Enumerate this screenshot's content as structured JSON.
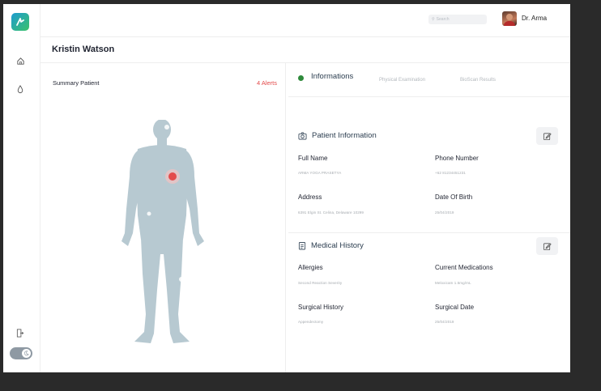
{
  "header": {
    "search_placeholder": "Search",
    "user_name": "Dr. Arma"
  },
  "patient": {
    "name": "Kristin Watson"
  },
  "summary": {
    "label": "Summary Patient",
    "alerts": "4 Alerts"
  },
  "tabs": [
    {
      "label": "Informations",
      "active": true
    },
    {
      "label": "Physical Examination",
      "active": false
    },
    {
      "label": "BioScan Results",
      "active": false
    }
  ],
  "patient_information": {
    "title": "Patient Information",
    "fields": [
      {
        "label": "Full Name",
        "value": "ARMA YOGA PRASETYA"
      },
      {
        "label": "Phone Number",
        "value": "+62 81234451231"
      },
      {
        "label": "Address",
        "value": "6391 Elgin St. Celina, Delaware 10299"
      },
      {
        "label": "Date Of Birth",
        "value": "25/04/2019"
      }
    ]
  },
  "medical_history": {
    "title": "Medical History",
    "fields": [
      {
        "label": "Allergies",
        "value": "Second Reaction Severity"
      },
      {
        "label": "Current Medications",
        "value": "Meloxicam 1.5mg/mL"
      },
      {
        "label": "Surgical History",
        "value": "Appendectomy"
      },
      {
        "label": "Surgical Date",
        "value": "25/04/2019"
      }
    ]
  },
  "colors": {
    "accent_green": "#2e8a3b",
    "alert_red": "#e34b4b",
    "body_silhouette": "#b7c9d1"
  },
  "icons": {
    "logo": "app-logo",
    "sidebar": [
      "home-icon",
      "drop-icon",
      "logout-icon",
      "theme-toggle"
    ],
    "sections": [
      "camera-icon",
      "clipboard-icon",
      "edit-icon"
    ]
  }
}
